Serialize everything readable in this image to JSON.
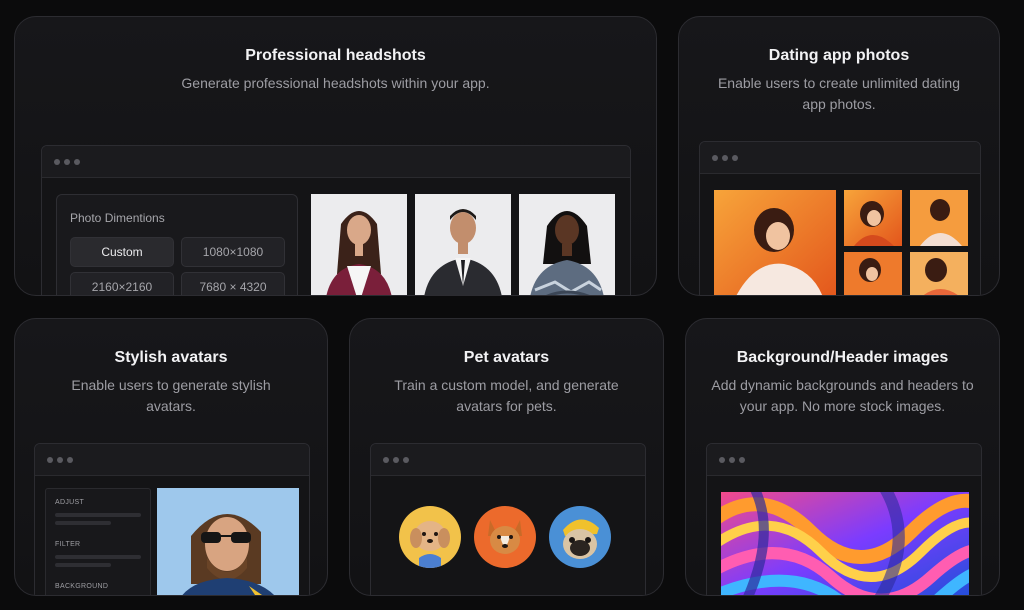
{
  "cards": {
    "headshots": {
      "title": "Professional headshots",
      "description": "Generate professional headshots within your app.",
      "panel_label": "Photo Dimentions",
      "options": [
        "Custom",
        "1080×1080",
        "2160×2160",
        "7680 × 4320"
      ],
      "selected_option": "Custom"
    },
    "dating": {
      "title": "Dating app photos",
      "description": "Enable users to create unlimited dating app photos."
    },
    "avatars": {
      "title": "Stylish avatars",
      "description": "Enable users to generate stylish avatars.",
      "sections": [
        "ADJUST",
        "FILTER",
        "BACKGROUND"
      ]
    },
    "pets": {
      "title": "Pet avatars",
      "description": "Train a custom model, and generate avatars for pets."
    },
    "backgrounds": {
      "title": "Background/Header images",
      "description": "Add dynamic backgrounds and headers to your app. No more stock images."
    }
  },
  "colors": {
    "page_bg": "#0b0b0c",
    "card_border": "#2c2c31",
    "accent_orange": "#f2731e"
  }
}
